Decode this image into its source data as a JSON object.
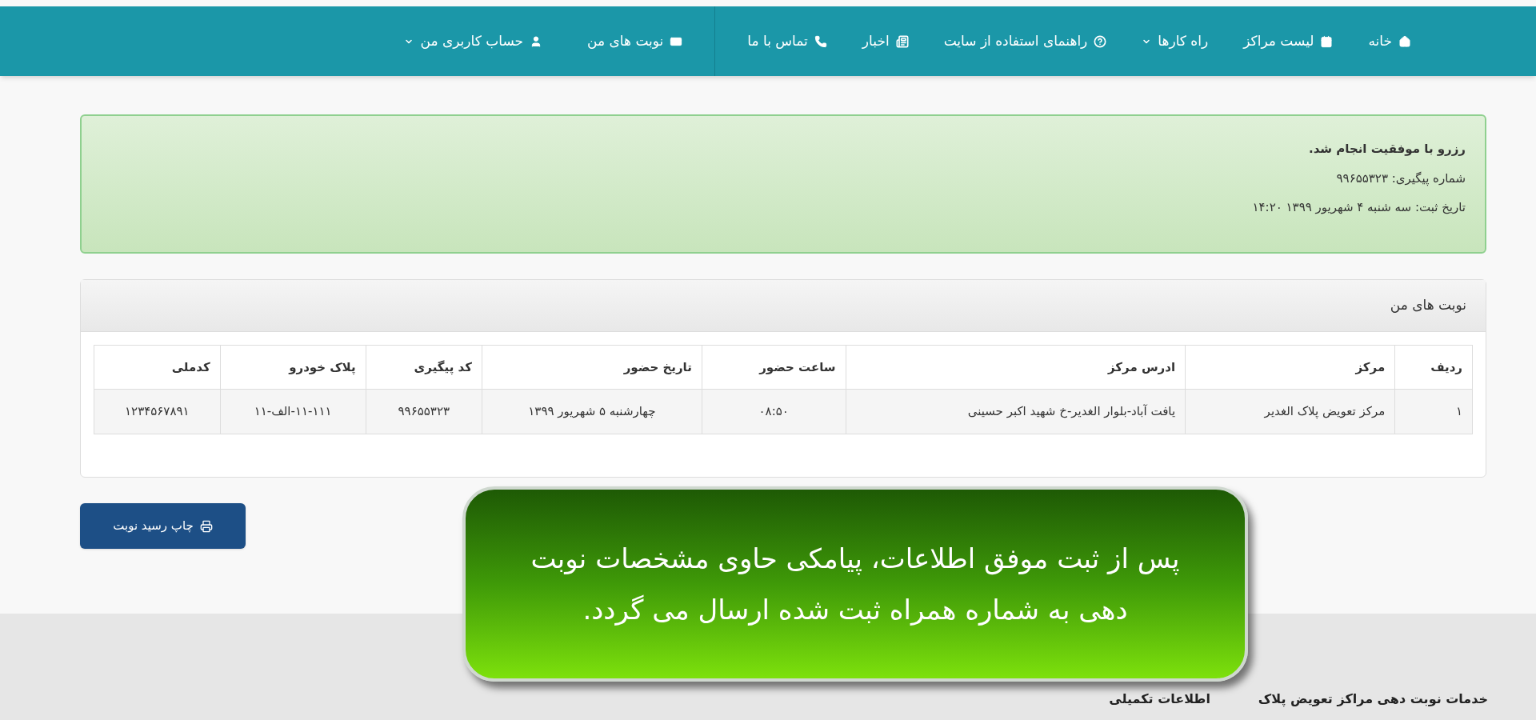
{
  "nav": {
    "main_items": [
      {
        "label": "خانه",
        "dropdown": false
      },
      {
        "label": "لیست مراکز",
        "dropdown": false
      },
      {
        "label": "راه کارها",
        "dropdown": true
      },
      {
        "label": "راهنمای استفاده از سایت",
        "dropdown": false
      },
      {
        "label": "اخبار",
        "dropdown": false
      },
      {
        "label": "تماس با ما",
        "dropdown": false
      }
    ],
    "user_items": [
      {
        "label": "نوبت های من",
        "dropdown": false
      },
      {
        "label": "حساب کاربری من",
        "dropdown": true
      }
    ]
  },
  "alert": {
    "title": "رزرو با موفقیت انجام شد.",
    "lines": [
      "شماره پیگیری: ۹۹۶۵۵۳۲۳",
      "تاریخ ثبت: سه شنبه ۴ شهریور ۱۳۹۹ ۱۴:۲۰"
    ]
  },
  "panel": {
    "title": "نوبت های من",
    "table": {
      "columns": [
        "ردیف",
        "مرکز",
        "ادرس مرکز",
        "ساعت حضور",
        "تاریخ حضور",
        "کد پیگیری",
        "پلاک خودرو",
        "کدملی"
      ],
      "rows": [
        [
          "۱",
          "مرکز تعویض پلاک الغدیر",
          "یافت آباد-بلوار الغدیر-خ شهید اکبر حسینی",
          "۰۸:۵۰",
          "چهارشنبه ۵ شهریور ۱۳۹۹",
          "۹۹۶۵۵۳۲۳",
          "۱۱-۱۱۱-الف-۱۱",
          "۱۲۳۴۵۶۷۸۹۱"
        ]
      ]
    }
  },
  "print_button": "چاپ رسید نوبت",
  "caption": {
    "lines": [
      "پس از ثبت موفق اطلاعات، پیامکی حاوی مشخصات نوبت",
      "دهی به شماره همراه ثبت شده ارسال می گردد."
    ]
  },
  "footer": {
    "columns": [
      {
        "title": "خدمات نوبت دهی مراکز تعویض پلاک"
      },
      {
        "title": "اطلاعات تکمیلی"
      }
    ]
  }
}
